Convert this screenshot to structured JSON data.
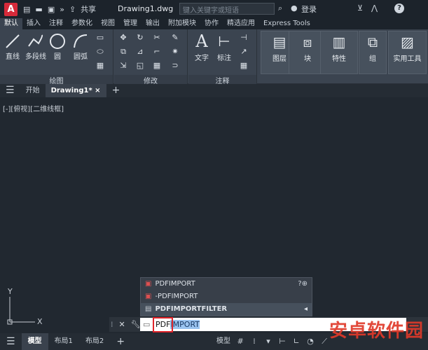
{
  "title": {
    "file": "Drawing1.dwg",
    "share": "共享",
    "search_placeholder": "键入关键字或短语",
    "login": "登录",
    "help": "?"
  },
  "menu_tabs": [
    "默认",
    "插入",
    "注释",
    "参数化",
    "视图",
    "管理",
    "输出",
    "附加模块",
    "协作",
    "精选应用",
    "Express Tools"
  ],
  "draw_tools": [
    "直线",
    "多段线",
    "圆",
    "圆弧"
  ],
  "groups": {
    "draw": "绘图",
    "modify": "修改",
    "annotate": "注释"
  },
  "annot_tools": [
    "文字",
    "标注"
  ],
  "panels": [
    "图层",
    "块",
    "特性",
    "组",
    "实用工具"
  ],
  "doc_tabs": {
    "start": "开始",
    "drawing": "Drawing1*",
    "add": "+"
  },
  "view_label": "[-][俯视][二维线框]",
  "ucs": {
    "x": "X",
    "y": "Y"
  },
  "autocomplete": [
    "PDFIMPORT",
    "-PDFIMPORT",
    "PDFIMPORTFILTER"
  ],
  "command": {
    "typed": "PDF",
    "completion": "IMPORT"
  },
  "status": {
    "model": "模型",
    "layout1": "布局1",
    "layout2": "布局2",
    "model_btn": "模型"
  },
  "watermark": "安卓软件园"
}
